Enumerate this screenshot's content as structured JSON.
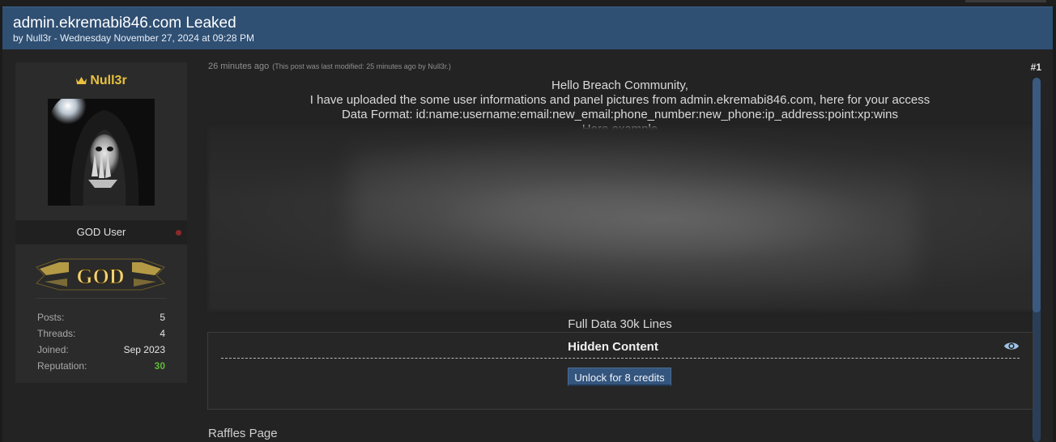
{
  "thread": {
    "title": "admin.ekremabi846.com Leaked",
    "byline": "by Null3r - Wednesday November 27, 2024 at 09:28 PM"
  },
  "user": {
    "name": "Null3r",
    "title": "GOD User",
    "badge": "GOD",
    "stats": [
      {
        "label": "Posts:",
        "value": "5"
      },
      {
        "label": "Threads:",
        "value": "4"
      },
      {
        "label": "Joined:",
        "value": "Sep 2023"
      },
      {
        "label": "Reputation:",
        "value": "30"
      }
    ],
    "name_color": "#e8c13c",
    "reputation_color": "#5fb93a"
  },
  "post": {
    "time": "26 minutes ago",
    "modified": "(This post was last modified: 25 minutes ago by Null3r.)",
    "number": "#1",
    "lines": [
      "Hello Breach Community,",
      "I have uploaded the some user informations and panel pictures from admin.ekremabi846.com, here for your access",
      "Data Format: id:name:username:email:new_email:phone_number:new_phone:ip_address:point:xp:wins",
      "Here example"
    ],
    "full_data": "Full Data 30k Lines",
    "hidden": {
      "title": "Hidden Content",
      "unlock_label": "Unlock for 8 credits",
      "icon": "eye-icon"
    },
    "raffles": "Raffles Page"
  },
  "colors": {
    "header_bg": "#2f4f73",
    "button_bg": "#34557d"
  }
}
